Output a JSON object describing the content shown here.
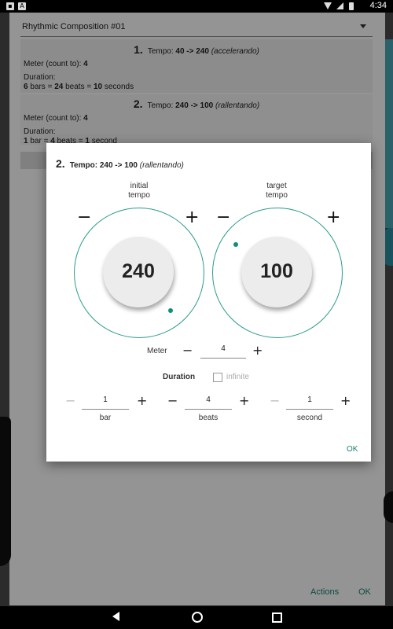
{
  "status_bar": {
    "time": "4:34"
  },
  "composition": {
    "select_value": "Rhythmic Composition #01",
    "sections": [
      {
        "number": "1.",
        "tempo_prefix": "Tempo: ",
        "tempo_range": "40 -> 240",
        "tempo_mode": "(accelerando)",
        "meter_label": "Meter (count to): ",
        "meter_value": "4",
        "duration_label": "Duration:",
        "duration_bars": "6",
        "duration_bars_unit": " bars = ",
        "duration_beats": "24",
        "duration_beats_unit": " beats = ",
        "duration_secs": "10",
        "duration_secs_unit": " seconds"
      },
      {
        "number": "2.",
        "tempo_prefix": "Tempo: ",
        "tempo_range": "240 -> 100",
        "tempo_mode": "(rallentando)",
        "meter_label": "Meter (count to): ",
        "meter_value": "4",
        "duration_label": "Duration:",
        "duration_bars": "1",
        "duration_bars_unit": " bar = ",
        "duration_beats": "4",
        "duration_beats_unit": " beats = ",
        "duration_secs": "1",
        "duration_secs_unit": " second"
      }
    ],
    "actions_label": "Actions",
    "ok_label": "OK"
  },
  "dialog": {
    "number": "2.",
    "title_prefix": "Tempo: ",
    "tempo_range": "240 -> 100",
    "tempo_mode": "(rallentando)",
    "initial_label_1": "initial",
    "initial_label_2": "tempo",
    "target_label_1": "target",
    "target_label_2": "tempo",
    "initial_tempo": "240",
    "target_tempo": "100",
    "minus": "−",
    "plus": "+",
    "meter_label": "Meter",
    "meter_value": "4",
    "duration_label": "Duration",
    "infinite_label": "infinite",
    "bar_value": "1",
    "bar_label": "bar",
    "beats_value": "4",
    "beats_label": "beats",
    "second_value": "1",
    "second_label": "second",
    "ok_label": "OK"
  },
  "colors": {
    "accent": "#1a7f6e",
    "dial_ring": "#2a9c8a"
  }
}
